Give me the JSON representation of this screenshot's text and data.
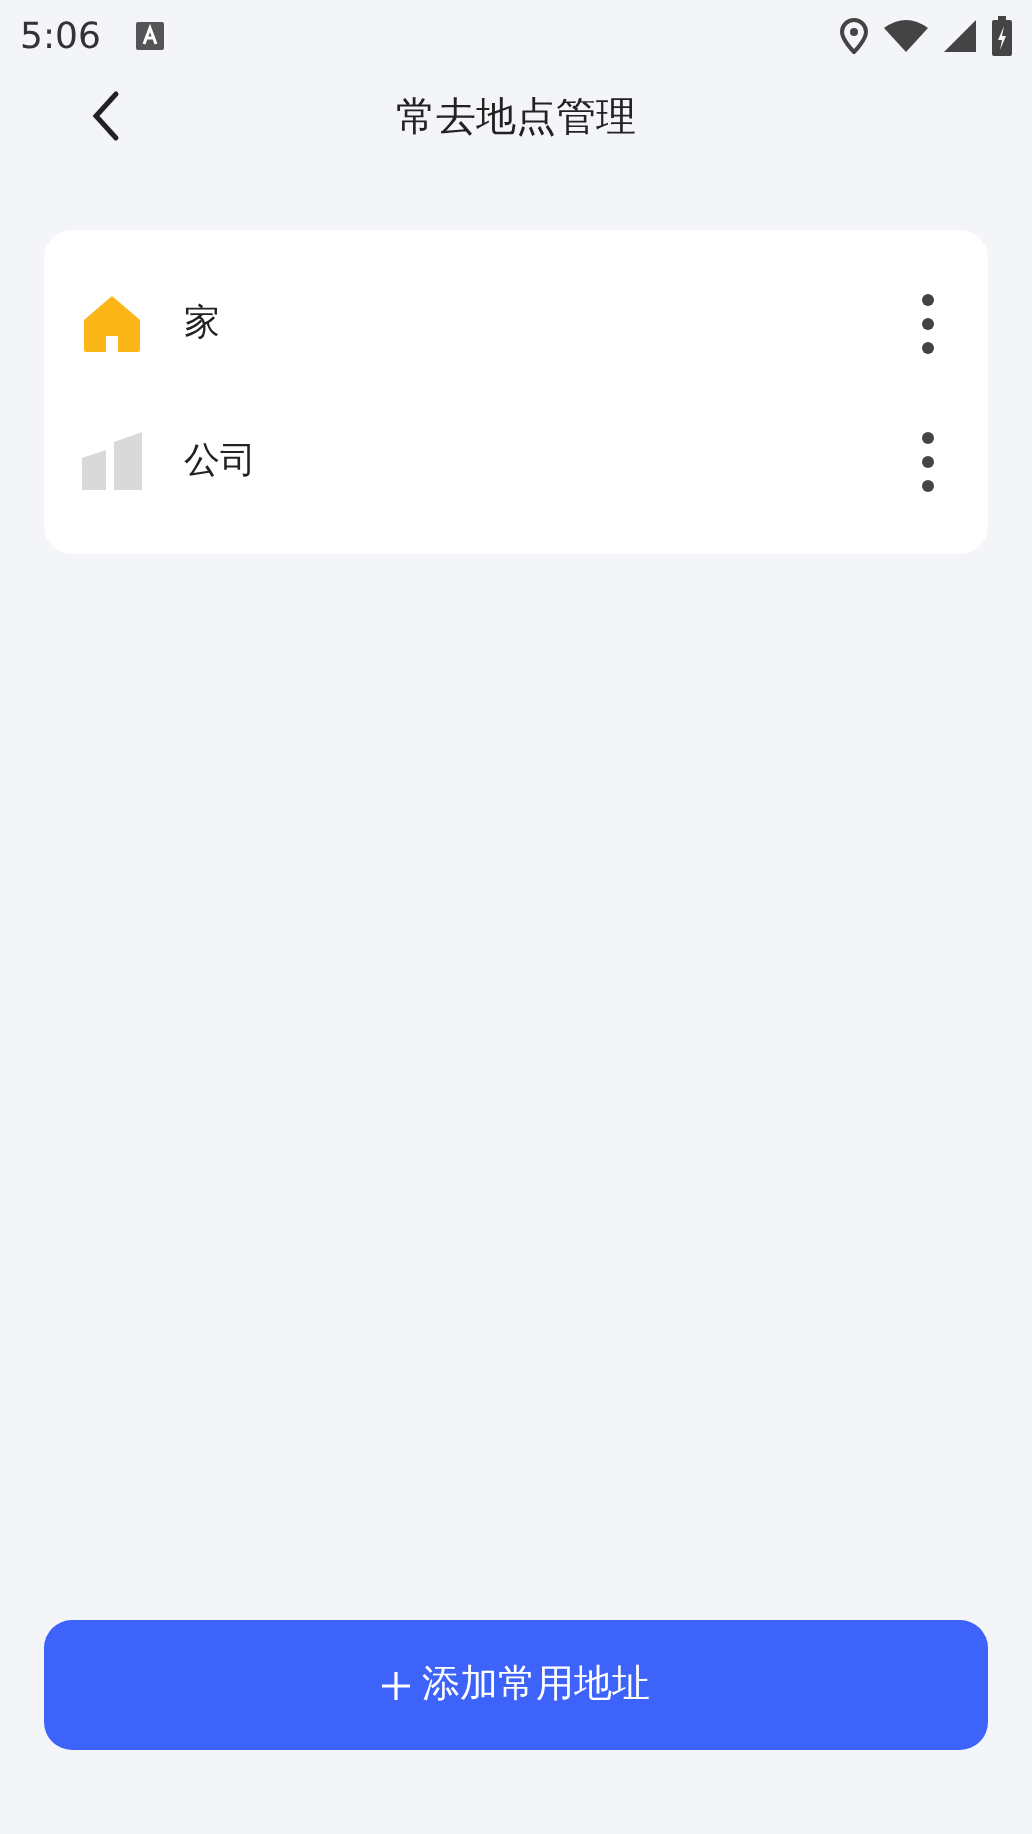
{
  "status_bar": {
    "time": "5:06"
  },
  "header": {
    "title": "常去地点管理"
  },
  "places": [
    {
      "name": "家",
      "kind": "home"
    },
    {
      "name": "公司",
      "kind": "company"
    }
  ],
  "add_button": {
    "label": "添加常用地址"
  }
}
